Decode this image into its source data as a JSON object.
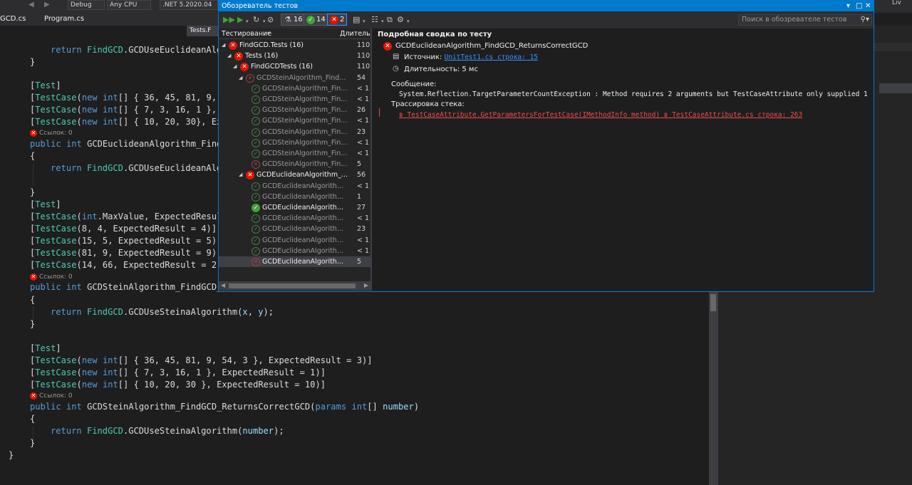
{
  "toolbar": {
    "config": "Debug",
    "platform": "Any CPU",
    "target": ".NET 5.2020.04",
    "right_label": "Liv"
  },
  "tabs": [
    {
      "label": "GCD.cs"
    },
    {
      "label": "Program.cs"
    }
  ],
  "sub_tab": {
    "label": "Tests.F"
  },
  "editor": {
    "references_label": "Ссылок: 0",
    "lines": [
      {
        "parts": [
          {
            "t": "return ",
            "c": "kw"
          },
          {
            "t": "FindGCD",
            "c": "cls"
          },
          {
            "t": ".GCDUseEuclideanAlg",
            "c": ""
          }
        ]
      },
      {
        "parts": [
          {
            "t": "}",
            "c": ""
          }
        ]
      },
      {
        "parts": [
          {
            "t": "[",
            "c": ""
          },
          {
            "t": "Test",
            "c": "cls"
          },
          {
            "t": "]",
            "c": ""
          }
        ]
      },
      {
        "parts": [
          {
            "t": "[",
            "c": ""
          },
          {
            "t": "TestCase",
            "c": "cls"
          },
          {
            "t": "(",
            "c": ""
          },
          {
            "t": "new ",
            "c": "kw"
          },
          {
            "t": "int",
            "c": "kw"
          },
          {
            "t": "[] { 36, 45, 81, 9, ",
            "c": ""
          }
        ]
      },
      {
        "parts": [
          {
            "t": "[",
            "c": ""
          },
          {
            "t": "TestCase",
            "c": "cls"
          },
          {
            "t": "(",
            "c": ""
          },
          {
            "t": "new ",
            "c": "kw"
          },
          {
            "t": "int",
            "c": "kw"
          },
          {
            "t": "[] { 7, 3, 16, 1 }, ",
            "c": ""
          }
        ]
      },
      {
        "parts": [
          {
            "t": "[",
            "c": ""
          },
          {
            "t": "TestCase",
            "c": "cls"
          },
          {
            "t": "(",
            "c": ""
          },
          {
            "t": "new ",
            "c": "kw"
          },
          {
            "t": "int",
            "c": "kw"
          },
          {
            "t": "[] { 10, 20, 30}, Ex",
            "c": ""
          }
        ]
      },
      {
        "parts": [
          {
            "t": "public ",
            "c": "kw"
          },
          {
            "t": "int ",
            "c": "kw"
          },
          {
            "t": "GCDEuclideanAlgorithm_Find",
            "c": ""
          }
        ]
      },
      {
        "parts": [
          {
            "t": "{",
            "c": ""
          }
        ]
      },
      {
        "parts": [
          {
            "t": "return ",
            "c": "kw"
          },
          {
            "t": "FindGCD",
            "c": "cls"
          },
          {
            "t": ".GCDUseEuclideanAlg",
            "c": ""
          }
        ]
      },
      {
        "parts": [
          {
            "t": "}",
            "c": ""
          }
        ]
      },
      {
        "parts": [
          {
            "t": "[",
            "c": ""
          },
          {
            "t": "Test",
            "c": "cls"
          },
          {
            "t": "]",
            "c": ""
          }
        ]
      },
      {
        "parts": [
          {
            "t": "[",
            "c": ""
          },
          {
            "t": "TestCase",
            "c": "cls"
          },
          {
            "t": "(",
            "c": ""
          },
          {
            "t": "int",
            "c": "kw"
          },
          {
            "t": ".MaxValue, ExpectedResul",
            "c": ""
          }
        ]
      },
      {
        "parts": [
          {
            "t": "[",
            "c": ""
          },
          {
            "t": "TestCase",
            "c": "cls"
          },
          {
            "t": "(8, 4, ExpectedResult = 4)]",
            "c": ""
          }
        ]
      },
      {
        "parts": [
          {
            "t": "[",
            "c": ""
          },
          {
            "t": "TestCase",
            "c": "cls"
          },
          {
            "t": "(15, 5, ExpectedResult = 5)]",
            "c": ""
          }
        ]
      },
      {
        "parts": [
          {
            "t": "[",
            "c": ""
          },
          {
            "t": "TestCase",
            "c": "cls"
          },
          {
            "t": "(81, 9, ExpectedResult = 9)]",
            "c": ""
          }
        ]
      },
      {
        "parts": [
          {
            "t": "[",
            "c": ""
          },
          {
            "t": "TestCase",
            "c": "cls"
          },
          {
            "t": "(14, 66, ExpectedResult = 2)",
            "c": ""
          }
        ]
      },
      {
        "parts": [
          {
            "t": "public ",
            "c": "kw"
          },
          {
            "t": "int ",
            "c": "kw"
          },
          {
            "t": "GCDSteinAlgorithm_FindGCD_",
            "c": ""
          }
        ]
      },
      {
        "parts": [
          {
            "t": "{",
            "c": ""
          }
        ]
      },
      {
        "parts": [
          {
            "t": "return ",
            "c": "kw"
          },
          {
            "t": "FindGCD",
            "c": "cls"
          },
          {
            "t": ".GCDUseSteinaAlgorithm(",
            "c": ""
          },
          {
            "t": "x",
            "c": "prop"
          },
          {
            "t": ", ",
            "c": ""
          },
          {
            "t": "y",
            "c": "prop"
          },
          {
            "t": ");",
            "c": ""
          }
        ]
      },
      {
        "parts": [
          {
            "t": "}",
            "c": ""
          }
        ]
      },
      {
        "parts": [
          {
            "t": "[",
            "c": ""
          },
          {
            "t": "Test",
            "c": "cls"
          },
          {
            "t": "]",
            "c": ""
          }
        ]
      },
      {
        "parts": [
          {
            "t": "[",
            "c": ""
          },
          {
            "t": "TestCase",
            "c": "cls"
          },
          {
            "t": "(",
            "c": ""
          },
          {
            "t": "new ",
            "c": "kw"
          },
          {
            "t": "int",
            "c": "kw"
          },
          {
            "t": "[] { 36, 45, 81, 9, 54, 3 }, ExpectedResult = 3)]",
            "c": ""
          }
        ]
      },
      {
        "parts": [
          {
            "t": "[",
            "c": ""
          },
          {
            "t": "TestCase",
            "c": "cls"
          },
          {
            "t": "(",
            "c": ""
          },
          {
            "t": "new ",
            "c": "kw"
          },
          {
            "t": "int",
            "c": "kw"
          },
          {
            "t": "[] { 7, 3, 16, 1 }, ExpectedResult = 1)]",
            "c": ""
          }
        ]
      },
      {
        "parts": [
          {
            "t": "[",
            "c": ""
          },
          {
            "t": "TestCase",
            "c": "cls"
          },
          {
            "t": "(",
            "c": ""
          },
          {
            "t": "new ",
            "c": "kw"
          },
          {
            "t": "int",
            "c": "kw"
          },
          {
            "t": "[] { 10, 20, 30 }, ExpectedResult = 10)]",
            "c": ""
          }
        ]
      },
      {
        "parts": [
          {
            "t": "public ",
            "c": "kw"
          },
          {
            "t": "int ",
            "c": "kw"
          },
          {
            "t": "GCDSteinAlgorithm_FindGCD_ReturnsCorrectGCD(",
            "c": ""
          },
          {
            "t": "params ",
            "c": "kw"
          },
          {
            "t": "int",
            "c": "kw"
          },
          {
            "t": "[] ",
            "c": ""
          },
          {
            "t": "number",
            "c": "prop"
          },
          {
            "t": ")",
            "c": ""
          }
        ]
      },
      {
        "parts": [
          {
            "t": "{",
            "c": ""
          }
        ]
      },
      {
        "parts": [
          {
            "t": "return ",
            "c": "kw"
          },
          {
            "t": "FindGCD",
            "c": "cls"
          },
          {
            "t": ".GCDUseSteinaAlgorithm(",
            "c": ""
          },
          {
            "t": "number",
            "c": "prop"
          },
          {
            "t": ");",
            "c": ""
          }
        ]
      },
      {
        "parts": [
          {
            "t": "}",
            "c": ""
          }
        ]
      },
      {
        "parts": [
          {
            "t": "}",
            "c": ""
          }
        ]
      }
    ]
  },
  "test_explorer": {
    "title": "Обозреватель тестов",
    "counters": {
      "total": "16",
      "passed": "14",
      "failed": "2"
    },
    "search_placeholder": "Поиск в обозревателе тестов",
    "tree_header": {
      "col1": "Тестирование",
      "col2": "Длительн"
    },
    "rows": [
      {
        "name": "FindGCD.Tests (16)",
        "dur": "110",
        "status": "fail",
        "level": 0,
        "expand": "◢"
      },
      {
        "name": "Tests (16)",
        "dur": "110",
        "status": "fail",
        "level": 1,
        "expand": "◢"
      },
      {
        "name": "FindGCDTests (16)",
        "dur": "110",
        "status": "fail",
        "level": 2,
        "expand": "◢"
      },
      {
        "name": "GCDSteinAlgorithm_Find...",
        "dur": "54",
        "status": "dfail",
        "level": 3,
        "expand": "◢",
        "dim": true
      },
      {
        "name": "GCDSteinAlgorithm_Fin...",
        "dur": "< 1",
        "status": "dpass",
        "level": 4,
        "dim": true
      },
      {
        "name": "GCDSteinAlgorithm_Fin...",
        "dur": "< 1",
        "status": "dpass",
        "level": 4,
        "dim": true
      },
      {
        "name": "GCDSteinAlgorithm_Fin...",
        "dur": "26",
        "status": "dpass",
        "level": 4,
        "dim": true
      },
      {
        "name": "GCDSteinAlgorithm_Fin...",
        "dur": "< 1",
        "status": "dpass",
        "level": 4,
        "dim": true
      },
      {
        "name": "GCDSteinAlgorithm_Fin...",
        "dur": "23",
        "status": "dpass",
        "level": 4,
        "dim": true
      },
      {
        "name": "GCDSteinAlgorithm_Fin...",
        "dur": "< 1",
        "status": "dpass",
        "level": 4,
        "dim": true
      },
      {
        "name": "GCDSteinAlgorithm_Fin...",
        "dur": "< 1",
        "status": "dpass",
        "level": 4,
        "dim": true
      },
      {
        "name": "GCDSteinAlgorithm_Fin...",
        "dur": "5",
        "status": "dfail",
        "level": 4,
        "dim": true
      },
      {
        "name": "GCDEuclideanAlgorithm_...",
        "dur": "56",
        "status": "fail",
        "level": 3,
        "expand": "◢"
      },
      {
        "name": "GCDEuclideanAlgorith...",
        "dur": "< 1",
        "status": "dpass",
        "level": 4,
        "dim": true
      },
      {
        "name": "GCDEuclideanAlgorith...",
        "dur": "1",
        "status": "dpass",
        "level": 4,
        "dim": true
      },
      {
        "name": "GCDEuclideanAlgorith...",
        "dur": "27",
        "status": "pass",
        "level": 4
      },
      {
        "name": "GCDEuclideanAlgorith...",
        "dur": "< 1",
        "status": "dpass",
        "level": 4,
        "dim": true
      },
      {
        "name": "GCDEuclideanAlgorith...",
        "dur": "23",
        "status": "dpass",
        "level": 4,
        "dim": true
      },
      {
        "name": "GCDEuclideanAlgorith...",
        "dur": "< 1",
        "status": "dpass",
        "level": 4,
        "dim": true
      },
      {
        "name": "GCDEuclideanAlgorith...",
        "dur": "< 1",
        "status": "dpass",
        "level": 4,
        "dim": true
      },
      {
        "name": "GCDEuclideanAlgorith...",
        "dur": "5",
        "status": "dfail",
        "level": 4,
        "selected": true
      }
    ],
    "detail": {
      "heading": "Подробная сводка по тесту",
      "test_name": "GCDEuclideanAlgorithm_FindGCD_ReturnsCorrectGCD",
      "source_label": "Источник:",
      "source_link": "UnitTest1.cs строка: 15",
      "duration_label": "Длительность: 5 мс",
      "message_label": "Сообщение:",
      "message": "System.Reflection.TargetParameterCountException : Method requires 2 arguments but TestCaseAttribute only supplied 1",
      "stack_label": "Трассировка стека:",
      "stack_line": "в TestCaseAttribute.GetParametersForTestCase(IMethodInfo method) в TestCaseAttribute.cs строка: 263"
    }
  }
}
